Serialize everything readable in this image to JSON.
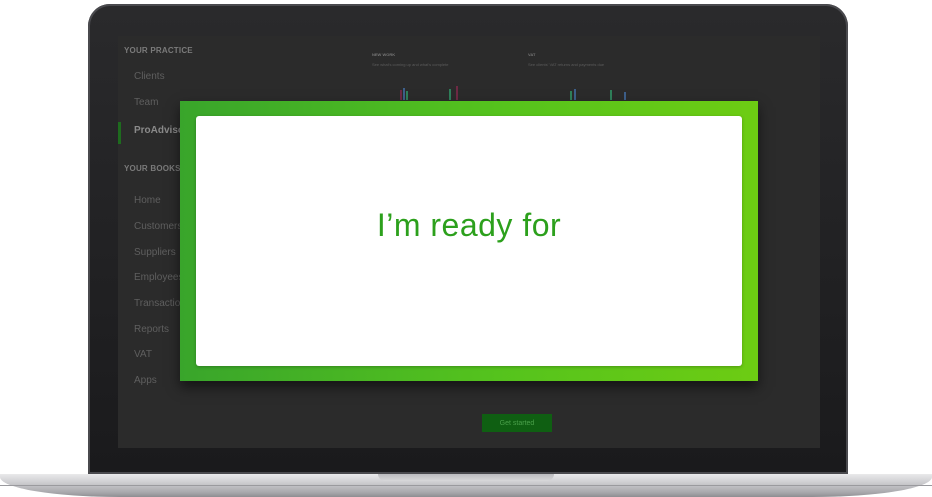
{
  "sidebar": {
    "practice_title": "YOUR PRACTICE",
    "practice_items": [
      {
        "label": "Clients"
      },
      {
        "label": "Team"
      },
      {
        "label": "ProAdvisor"
      }
    ],
    "books_title": "YOUR BOOKS",
    "books_items": [
      {
        "label": "Home"
      },
      {
        "label": "Customers"
      },
      {
        "label": "Suppliers"
      },
      {
        "label": "Employees"
      },
      {
        "label": "Transactions"
      },
      {
        "label": "Reports"
      },
      {
        "label": "VAT"
      },
      {
        "label": "Apps"
      }
    ]
  },
  "panels": [
    {
      "title": "NEW WORK",
      "subtitle": "See what's coming up and what's complete"
    },
    {
      "title": "VAT",
      "subtitle": "See clients' VAT returns and payments due"
    }
  ],
  "cta": {
    "label": "Get started"
  },
  "overlay": {
    "text": "I’m ready for"
  },
  "colors": {
    "brand_green": "#2ca01c",
    "overlay_frame_left": "#39a52b",
    "overlay_frame_right": "#6dcc13",
    "cta_background": "#0f5f12"
  }
}
